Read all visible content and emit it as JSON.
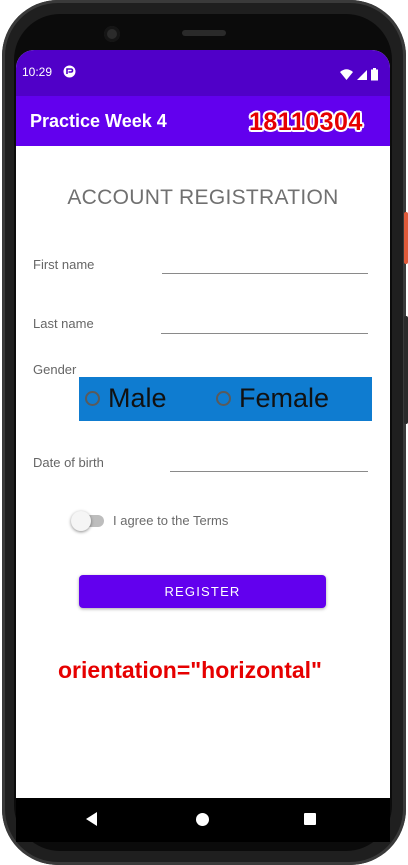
{
  "status_bar": {
    "time": "10:29"
  },
  "app_bar": {
    "title": "Practice Week 4",
    "student_id": "18110304"
  },
  "form": {
    "title": "ACCOUNT REGISTRATION",
    "first_name_label": "First name",
    "first_name_value": "",
    "last_name_label": "Last name",
    "last_name_value": "",
    "gender_label": "Gender",
    "gender_options": [
      "Male",
      "Female"
    ],
    "date_of_birth_label": "Date of birth",
    "date_of_birth_value": "",
    "terms_label": "I agree to the Terms",
    "terms_checked": false,
    "register_label": "REGISTER"
  },
  "annotation": {
    "text": "orientation=\"horizontal\""
  },
  "colors": {
    "status_bar": "#5000c8",
    "app_bar": "#6200ee",
    "accent": "#6200ee",
    "gender_background": "#0f7cd0",
    "annotation": "#e60000"
  },
  "icons": {
    "status": [
      "google-icon",
      "wifi-icon",
      "signal-icon",
      "battery-icon"
    ],
    "nav": [
      "back-icon",
      "home-icon",
      "recents-icon"
    ]
  }
}
